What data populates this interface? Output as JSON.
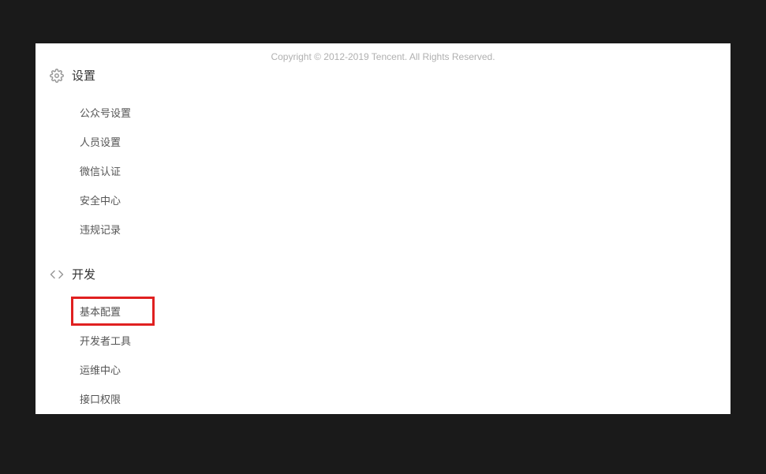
{
  "copyright": "Copyright © 2012-2019 Tencent. All Rights Reserved.",
  "sections": {
    "settings": {
      "title": "设置",
      "items": [
        "公众号设置",
        "人员设置",
        "微信认证",
        "安全中心",
        "违规记录"
      ]
    },
    "develop": {
      "title": "开发",
      "items": [
        "基本配置",
        "开发者工具",
        "运维中心",
        "接口权限"
      ]
    }
  }
}
